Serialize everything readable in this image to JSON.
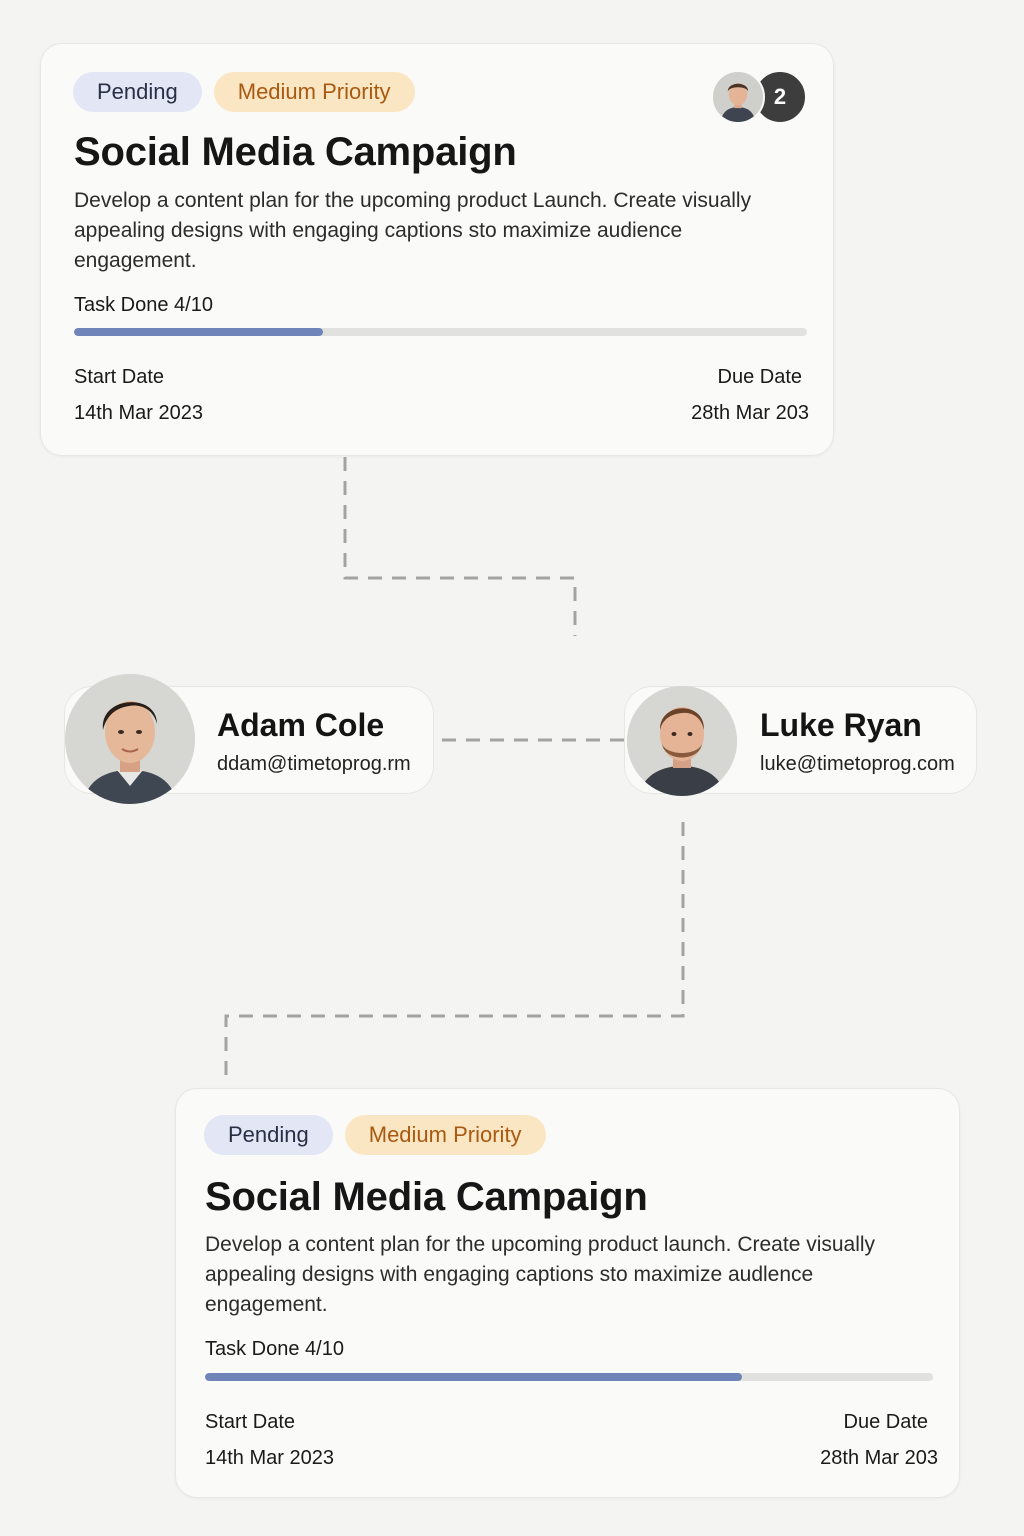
{
  "cards": [
    {
      "status": "Pending",
      "priority": "Medium Priority",
      "title": "Social Media Campaign",
      "description": "Develop a content plan for the upcoming product Launch. Create visually appealing designs with engaging captions sto maximize audience engagement.",
      "task_label": "Task Done 4/10",
      "progress": 0.34,
      "start_label": "Start Date",
      "start_date": "14th Mar 2023",
      "due_label": "Due Date",
      "due_date": "28th Mar 203",
      "extra_assignees": "2"
    },
    {
      "status": "Pending",
      "priority": "Medium Priority",
      "title": "Social Media Campaign",
      "description": "Develop a content plan for the upcoming product launch. Create visually appealing designs with engaging captions sto maximize audlence engagement.",
      "task_label": "Task Done 4/10",
      "progress": 0.737,
      "start_label": "Start Date",
      "start_date": "14th Mar 2023",
      "due_label": "Due Date",
      "due_date": "28th Mar 203"
    }
  ],
  "people": [
    {
      "name": "Adam Cole",
      "email": "ddam@timetoprog.rm"
    },
    {
      "name": "Luke Ryan",
      "email": "luke@timetoprog.com"
    }
  ],
  "colors": {
    "background": "#f4f4f2",
    "progress_fill": "#6f84b8",
    "pending_badge": "#e2e6f5",
    "priority_badge": "#fbe6c4",
    "priority_text": "#a85a10"
  }
}
